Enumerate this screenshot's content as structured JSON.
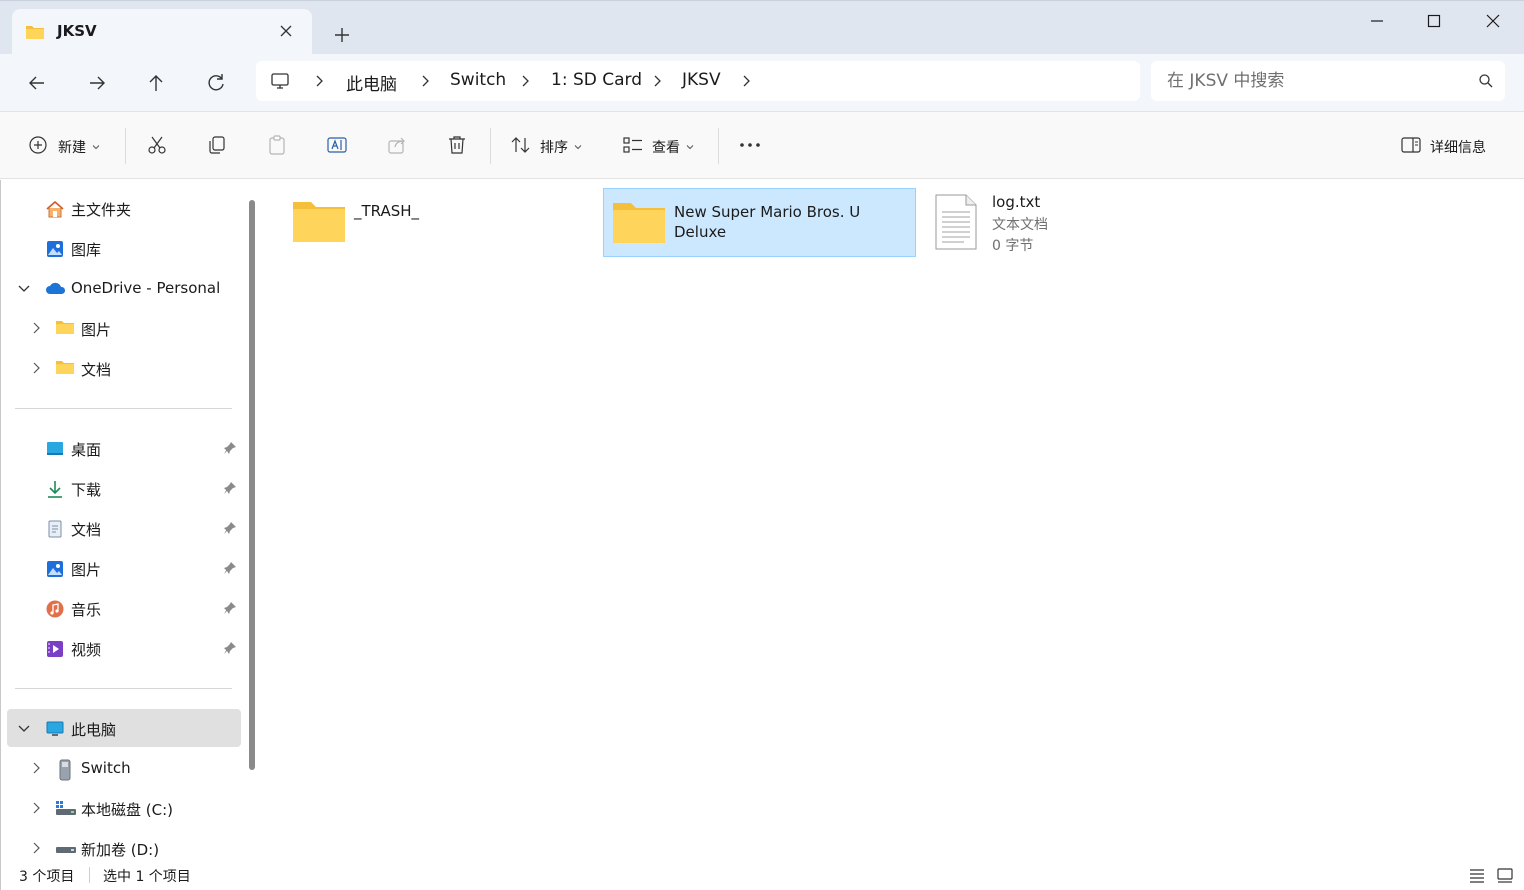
{
  "tab": {
    "title": "JKSV",
    "icon": "folder-icon"
  },
  "window": {
    "controls": [
      "minimize",
      "maximize",
      "close"
    ]
  },
  "address": {
    "root_icon": "pc-icon",
    "crumbs": [
      "此电脑",
      "Switch",
      "1: SD Card",
      "JKSV"
    ]
  },
  "search": {
    "placeholder": "在 JKSV 中搜索"
  },
  "toolbar": {
    "new_label": "新建",
    "sort_label": "排序",
    "view_label": "查看",
    "more_label": "...",
    "details_label": "详细信息"
  },
  "sidebar": {
    "items": [
      {
        "label": "主文件夹",
        "icon": "home-icon"
      },
      {
        "label": "图库",
        "icon": "gallery-icon"
      },
      {
        "label": "OneDrive - Personal",
        "icon": "cloud-icon",
        "expanded": true
      },
      {
        "label": "图片",
        "icon": "folder-icon"
      },
      {
        "label": "文档",
        "icon": "folder-icon"
      },
      {
        "label": "桌面",
        "icon": "desktop-icon",
        "pinned": true
      },
      {
        "label": "下载",
        "icon": "download-icon",
        "pinned": true
      },
      {
        "label": "文档",
        "icon": "document-icon",
        "pinned": true
      },
      {
        "label": "图片",
        "icon": "pictures-icon",
        "pinned": true
      },
      {
        "label": "音乐",
        "icon": "music-icon",
        "pinned": true
      },
      {
        "label": "视频",
        "icon": "video-icon",
        "pinned": true
      },
      {
        "label": "此电脑",
        "icon": "pc-icon",
        "expanded": true,
        "selected": true
      },
      {
        "label": "Switch",
        "icon": "device-icon"
      },
      {
        "label": "本地磁盘 (C:)",
        "icon": "drive-icon"
      },
      {
        "label": "新加卷 (D:)",
        "icon": "drive-icon"
      }
    ]
  },
  "files": [
    {
      "name": "_TRASH_",
      "type": "folder",
      "selected": false
    },
    {
      "name": "New Super Mario Bros. U Deluxe",
      "type": "folder",
      "selected": true
    },
    {
      "name": "log.txt",
      "type": "file",
      "kind": "文本文档",
      "size": "0 字节",
      "selected": false
    }
  ],
  "status": {
    "item_count": "3 个项目",
    "selected_count": "选中 1 个项目"
  },
  "colors": {
    "accent": "#0067c0",
    "selection": "#cce8ff",
    "folder": "#ffd45a",
    "titlebar": "#dfe6ef"
  }
}
